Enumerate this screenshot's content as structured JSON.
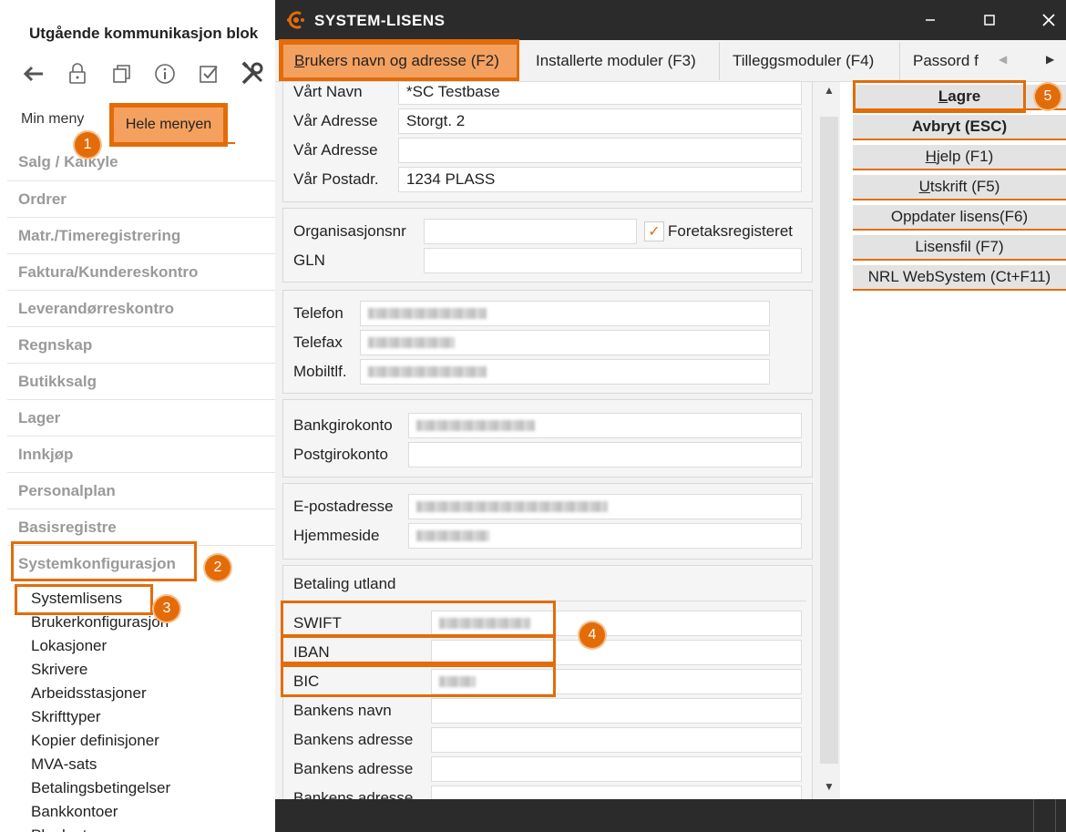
{
  "left_panel": {
    "title": "Utgående kommunikasjon blok",
    "toolbar_icons": [
      "back-arrow-icon",
      "lock-icon",
      "copy-icon",
      "info-icon",
      "checkbox-icon",
      "tools-icon"
    ],
    "tabs": {
      "my_menu": "Min meny",
      "full_menu": "Hele menyen"
    },
    "menu_items": [
      "Salg / Kalkyle",
      "Ordrer",
      "Matr./Timeregistrering",
      "Faktura/Kundereskontro",
      "Leverandørreskontro",
      "Regnskap",
      "Butikksalg",
      "Lager",
      "Innkjøp",
      "Personalplan",
      "Basisregistre",
      "Systemkonfigurasjon"
    ],
    "sub_items": [
      "Systemlisens",
      "Brukerkonfigurasjon",
      "Lokasjoner",
      "Skrivere",
      "Arbeidsstasjoner",
      "Skrifttyper",
      "Kopier definisjoner",
      "MVA-sats",
      "Betalingsbetingelser",
      "Bankkontoer",
      "Planlagte oppgaver"
    ]
  },
  "dialog": {
    "title": "SYSTEM-LISENS",
    "window_controls": [
      "minimize-icon",
      "maximize-icon",
      "close-icon"
    ],
    "tabs": [
      {
        "label_underlined": "B",
        "label_rest": "rukers navn og adresse (F2)"
      },
      {
        "label_underlined": "",
        "label_rest": "Installerte moduler (F3)"
      },
      {
        "label_underlined": "",
        "label_rest": "Tilleggsmoduler (F4)"
      },
      {
        "label_underlined": "",
        "label_rest": "Passord f"
      }
    ],
    "address": {
      "vart_navn_label": "Vårt Navn",
      "vart_navn_value": "*SC Testbase",
      "adresse1_label": "Vår  Adresse",
      "adresse1_value": "Storgt. 2",
      "adresse2_label": "Vår  Adresse",
      "adresse2_value": "",
      "postadr_label": "Vår  Postadr.",
      "postadr_value": "1234 PLASS"
    },
    "org": {
      "orgnr_label": "Organisasjonsnr",
      "orgnr_value": "",
      "foretak_checkbox_checked": "✓",
      "foretak_label": "Foretaksregisteret",
      "gln_label": "GLN",
      "gln_value": ""
    },
    "phone": {
      "telefon_label": "Telefon",
      "telefax_label": "Telefax",
      "mobil_label": "Mobiltlf."
    },
    "bank": {
      "bankgiro_label": "Bankgirokonto",
      "postgiro_label": "Postgirokonto"
    },
    "web": {
      "epost_label": "E-postadresse",
      "hjemmeside_label": "Hjemmeside"
    },
    "foreign": {
      "title": "Betaling utland",
      "swift_label": "SWIFT",
      "iban_label": "IBAN",
      "bic_label": "BIC",
      "bank_name_label": "Bankens navn",
      "bank_addr1_label": "Bankens adresse",
      "bank_addr2_label": "Bankens adresse",
      "bank_addr3_label": "Bankens adresse"
    },
    "actions": {
      "save_underlined": "L",
      "save_rest": "agre",
      "cancel": "Avbryt (ESC)",
      "help_underlined": "H",
      "help_rest": "jelp (F1)",
      "print_underlined": "U",
      "print_rest": "tskrift (F5)",
      "update_license": "Oppdater lisens(F6)",
      "license_file": "Lisensfil (F7)",
      "websystem": "NRL WebSystem (Ct+F11)"
    }
  },
  "annotations": [
    "1",
    "2",
    "3",
    "4",
    "5"
  ],
  "colors": {
    "accent": "#e36c09",
    "accent_fill": "#f4a15f",
    "titlebar": "#2b2b2b"
  }
}
